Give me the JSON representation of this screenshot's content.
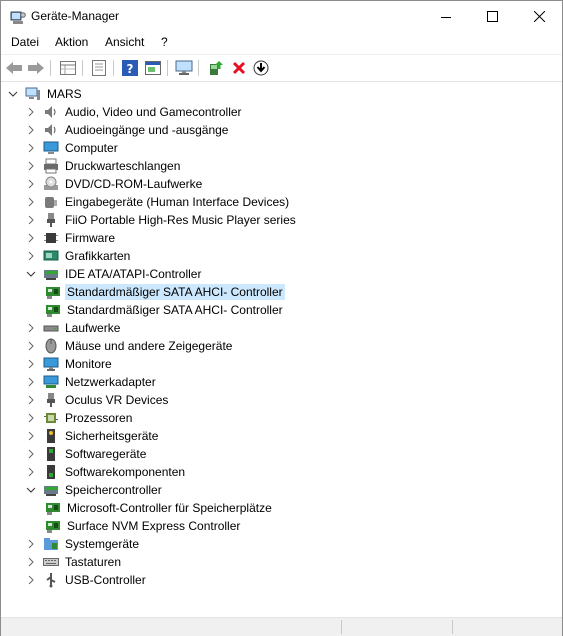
{
  "window": {
    "title": "Geräte-Manager"
  },
  "menu": [
    {
      "label": "Datei"
    },
    {
      "label": "Aktion"
    },
    {
      "label": "Ansicht"
    },
    {
      "label": "?"
    }
  ],
  "toolbar": [
    "back-arrow-icon",
    "forward-arrow-icon",
    "properties-grid-icon",
    "document-icon",
    "help-icon",
    "window-properties-icon",
    "monitor-network-icon",
    "update-driver-icon",
    "uninstall-x-icon",
    "download-icon"
  ],
  "tree": {
    "root": {
      "label": "MARS",
      "expanded": true
    },
    "items": [
      {
        "label": "Audio, Video und Gamecontroller",
        "icon": "speaker-icon",
        "level": 1,
        "expander": "collapsed"
      },
      {
        "label": "Audioeingänge und -ausgänge",
        "icon": "speaker-icon",
        "level": 1,
        "expander": "collapsed"
      },
      {
        "label": "Computer",
        "icon": "computer-icon",
        "level": 1,
        "expander": "collapsed"
      },
      {
        "label": "Druckwarteschlangen",
        "icon": "printer-icon",
        "level": 1,
        "expander": "collapsed"
      },
      {
        "label": "DVD/CD-ROM-Laufwerke",
        "icon": "dvd-drive-icon",
        "level": 1,
        "expander": "collapsed"
      },
      {
        "label": "Eingabegeräte (Human Interface Devices)",
        "icon": "hid-icon",
        "level": 1,
        "expander": "collapsed"
      },
      {
        "label": "FiiO Portable High-Res Music Player series",
        "icon": "usb-plug-icon",
        "level": 1,
        "expander": "collapsed"
      },
      {
        "label": "Firmware",
        "icon": "chip-icon",
        "level": 1,
        "expander": "collapsed"
      },
      {
        "label": "Grafikkarten",
        "icon": "display-adapter-icon",
        "level": 1,
        "expander": "collapsed"
      },
      {
        "label": "IDE ATA/ATAPI-Controller",
        "icon": "storage-controller-icon",
        "level": 1,
        "expander": "expanded"
      },
      {
        "label": "Standardmäßiger SATA AHCI- Controller",
        "icon": "controller-card-icon",
        "level": 2,
        "expander": "none",
        "selected": true
      },
      {
        "label": "Standardmäßiger SATA AHCI- Controller",
        "icon": "controller-card-icon",
        "level": 2,
        "expander": "none"
      },
      {
        "label": "Laufwerke",
        "icon": "disk-drive-icon",
        "level": 1,
        "expander": "collapsed"
      },
      {
        "label": "Mäuse und andere Zeigegeräte",
        "icon": "mouse-icon",
        "level": 1,
        "expander": "collapsed"
      },
      {
        "label": "Monitore",
        "icon": "monitor-icon",
        "level": 1,
        "expander": "collapsed"
      },
      {
        "label": "Netzwerkadapter",
        "icon": "network-adapter-icon",
        "level": 1,
        "expander": "collapsed"
      },
      {
        "label": "Oculus VR Devices",
        "icon": "usb-plug-icon",
        "level": 1,
        "expander": "collapsed"
      },
      {
        "label": "Prozessoren",
        "icon": "processor-icon",
        "level": 1,
        "expander": "collapsed"
      },
      {
        "label": "Sicherheitsgeräte",
        "icon": "security-key-icon",
        "level": 1,
        "expander": "collapsed"
      },
      {
        "label": "Softwaregeräte",
        "icon": "software-device-icon",
        "level": 1,
        "expander": "collapsed"
      },
      {
        "label": "Softwarekomponenten",
        "icon": "software-component-icon",
        "level": 1,
        "expander": "collapsed"
      },
      {
        "label": "Speichercontroller",
        "icon": "storage-controller-icon",
        "level": 1,
        "expander": "expanded"
      },
      {
        "label": "Microsoft-Controller für Speicherplätze",
        "icon": "controller-card-icon",
        "level": 2,
        "expander": "none"
      },
      {
        "label": "Surface NVM Express Controller",
        "icon": "controller-card-icon",
        "level": 2,
        "expander": "none"
      },
      {
        "label": "Systemgeräte",
        "icon": "system-folder-icon",
        "level": 1,
        "expander": "collapsed"
      },
      {
        "label": "Tastaturen",
        "icon": "keyboard-icon",
        "level": 1,
        "expander": "collapsed"
      },
      {
        "label": "USB-Controller",
        "icon": "usb-controller-icon",
        "level": 1,
        "expander": "collapsed"
      }
    ]
  },
  "colors": {
    "selection": "#cce8ff",
    "accent_blue": "#0078d7",
    "remove_red": "#e81123"
  }
}
